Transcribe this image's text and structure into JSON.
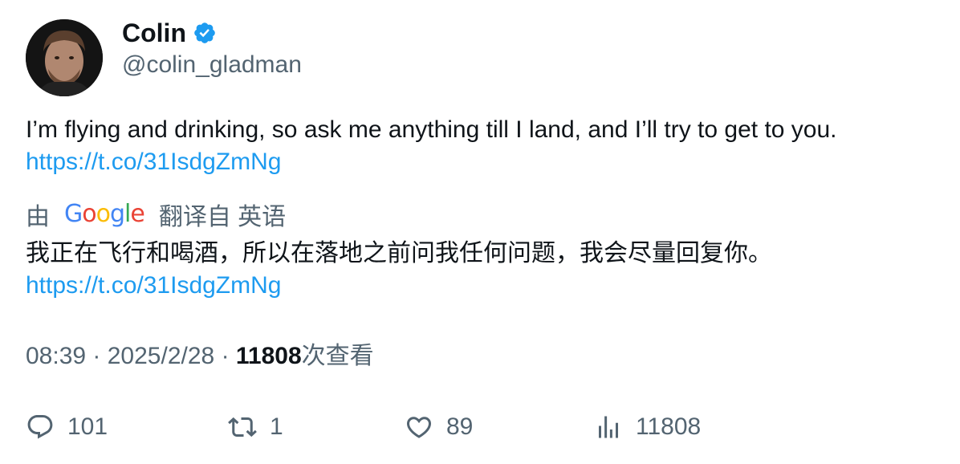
{
  "author": {
    "display_name": "Colin",
    "handle": "@colin_gladman",
    "verified": true,
    "avatar_icon": "profile-photo"
  },
  "tweet": {
    "text": "I’m flying and drinking, so ask me anything till I land, and I’ll try to get to you.",
    "link": "https://t.co/31IsdgZmNg"
  },
  "translation": {
    "prefix": "由",
    "provider": "Google",
    "suffix": "翻译自 英语",
    "text": "我正在飞行和喝酒，所以在落地之前问我任何问题，我会尽量回复你。",
    "link": "https://t.co/31IsdgZmNg"
  },
  "meta": {
    "time": "08:39",
    "separator": "·",
    "date": "2025/2/28",
    "views": "11808",
    "views_label": "次查看"
  },
  "actions": {
    "replies": "101",
    "retweets": "1",
    "likes": "89",
    "views": "11808"
  },
  "colors": {
    "link": "#1d9bf0",
    "secondary": "#536471",
    "primary": "#0f1419",
    "verified": "#1d9bf0"
  }
}
